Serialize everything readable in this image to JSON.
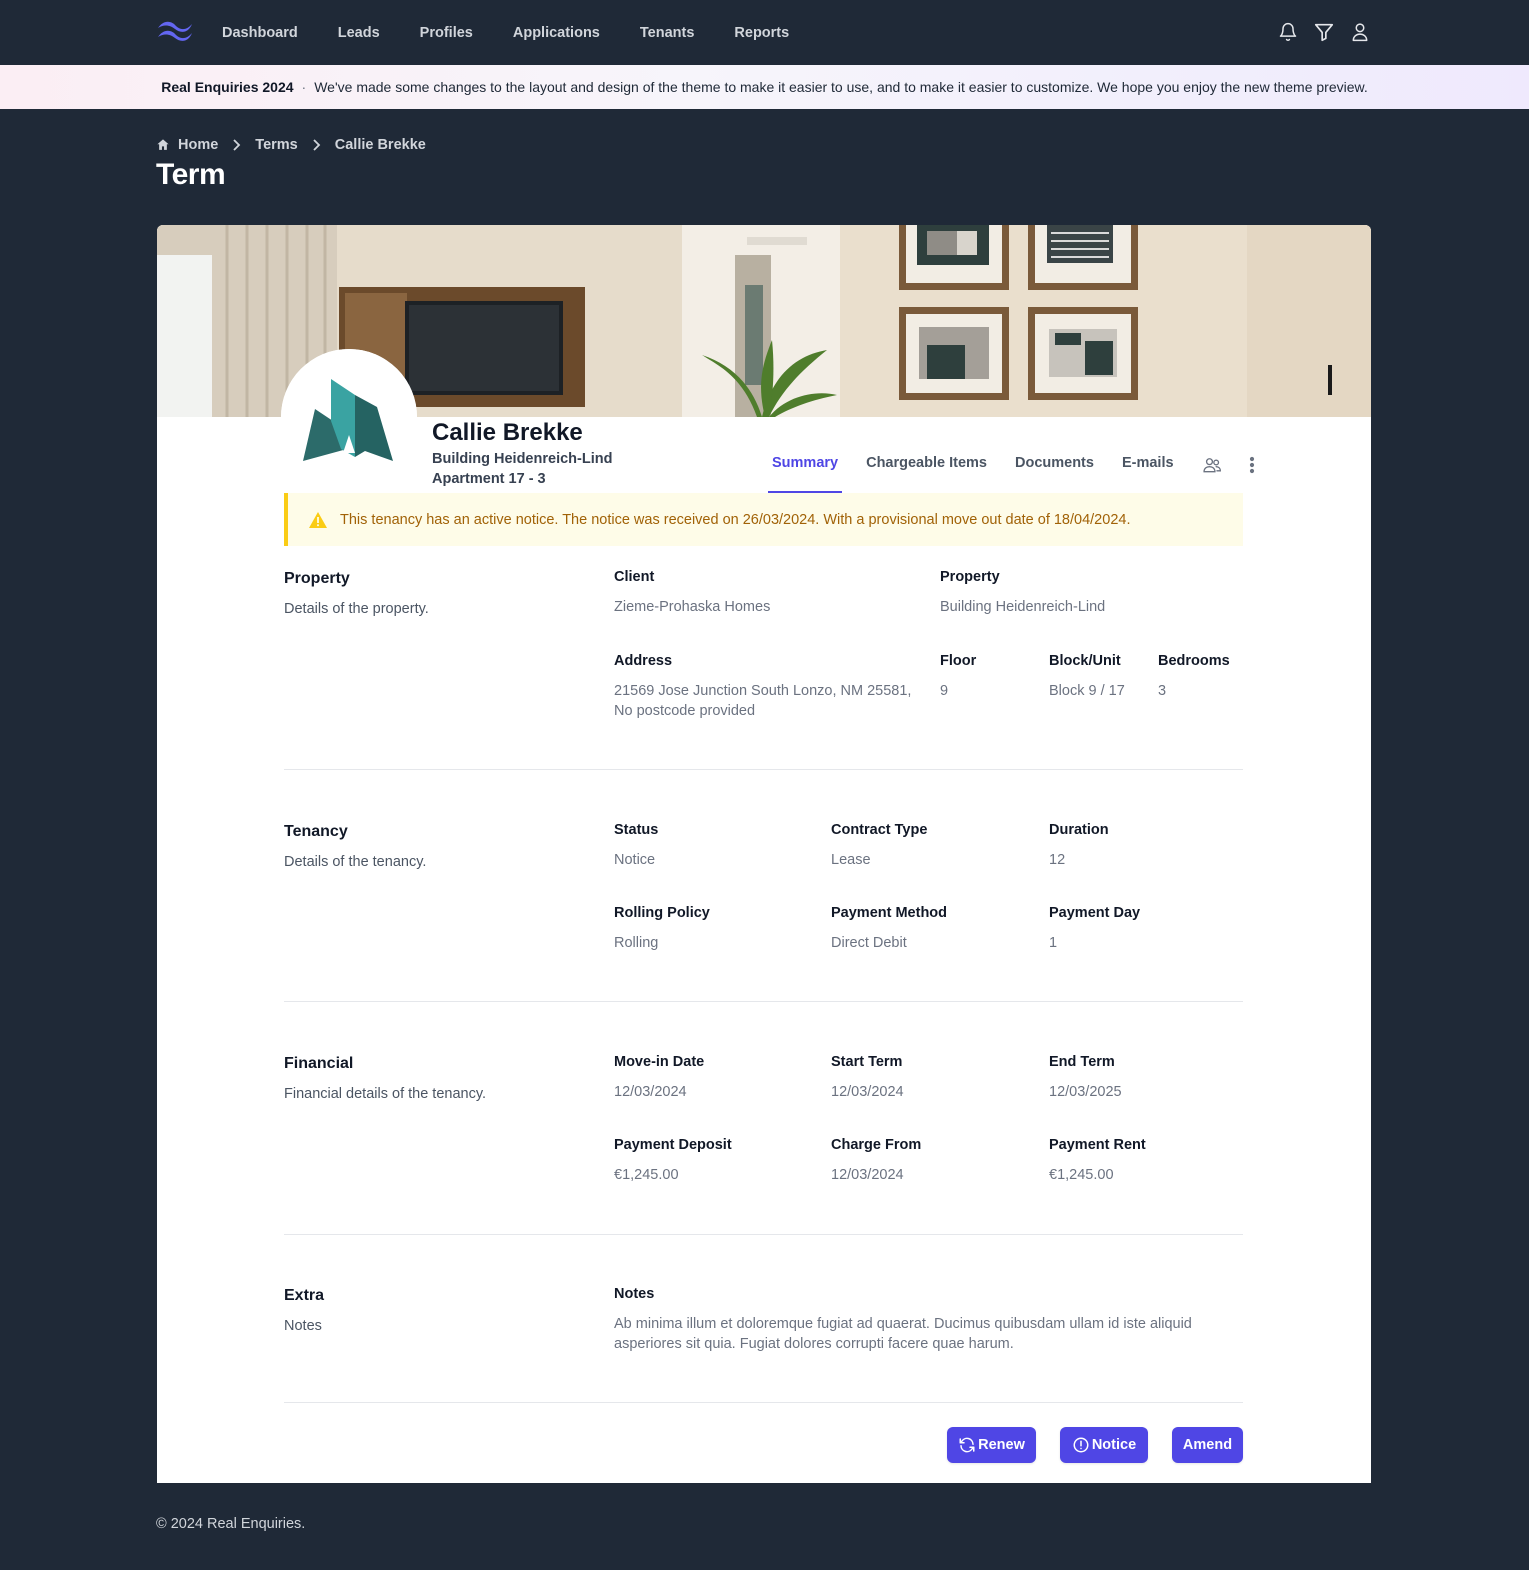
{
  "nav": {
    "links": [
      "Dashboard",
      "Leads",
      "Profiles",
      "Applications",
      "Tenants",
      "Reports"
    ],
    "icons": [
      "bell-icon",
      "filter-icon",
      "user-icon"
    ],
    "accent": "#4f46e5"
  },
  "banner": {
    "title": "Real Enquiries 2024",
    "separator": "·",
    "message": "We've made some changes to the layout and design of the theme to make it easier to use, and to make it easier to customize. We hope you enjoy the new theme preview."
  },
  "breadcrumb": {
    "home": "Home",
    "terms": "Terms",
    "current": "Callie Brekke"
  },
  "page_title": "Term",
  "profile": {
    "name": "Callie Brekke",
    "building": "Building Heidenreich-Lind",
    "apartment": "Apartment 17 - 3"
  },
  "tabs": [
    "Summary",
    "Chargeable Items",
    "Documents",
    "E-mails"
  ],
  "alert": {
    "text": "This tenancy has an active notice. The notice was received on 26/03/2024. With a provisional move out date of 18/04/2024.",
    "color": "#a16207"
  },
  "property": {
    "title": "Property",
    "description": "Details of the property.",
    "client_label": "Client",
    "client": "Zieme-Prohaska Homes",
    "property_label": "Property",
    "property": "Building Heidenreich-Lind",
    "address_label": "Address",
    "address_line1": "21569 Jose Junction South Lonzo, NM 25581,",
    "address_line2": "No postcode provided",
    "floor_label": "Floor",
    "floor": "9",
    "block_label": "Block/Unit",
    "block": "Block 9 / 17",
    "bedrooms_label": "Bedrooms",
    "bedrooms": "3"
  },
  "tenancy": {
    "title": "Tenancy",
    "description": "Details of the tenancy.",
    "status_label": "Status",
    "status": "Notice",
    "contract_label": "Contract Type",
    "contract": "Lease",
    "duration_label": "Duration",
    "duration": "12",
    "rolling_label": "Rolling Policy",
    "rolling": "Rolling",
    "method_label": "Payment Method",
    "method": "Direct Debit",
    "day_label": "Payment Day",
    "day": "1"
  },
  "financial": {
    "title": "Financial",
    "description": "Financial details of the tenancy.",
    "movein_label": "Move-in Date",
    "movein": "12/03/2024",
    "start_label": "Start Term",
    "start": "12/03/2024",
    "end_label": "End Term",
    "end": "12/03/2025",
    "deposit_label": "Payment Deposit",
    "deposit": "€1,245.00",
    "charge_label": "Charge From",
    "charge": "12/03/2024",
    "rent_label": "Payment Rent",
    "rent": "€1,245.00"
  },
  "extra": {
    "title": "Extra",
    "description": "Notes",
    "notes_label": "Notes",
    "notes_line1": "Ab minima illum et doloremque fugiat ad quaerat. Ducimus quibusdam ullam id iste aliquid",
    "notes_line2": "asperiores sit quia. Fugiat dolores corrupti facere quae harum."
  },
  "actions": {
    "renew": "Renew",
    "notice": "Notice",
    "amend": "Amend"
  },
  "footer": "© 2024 Real Enquiries."
}
